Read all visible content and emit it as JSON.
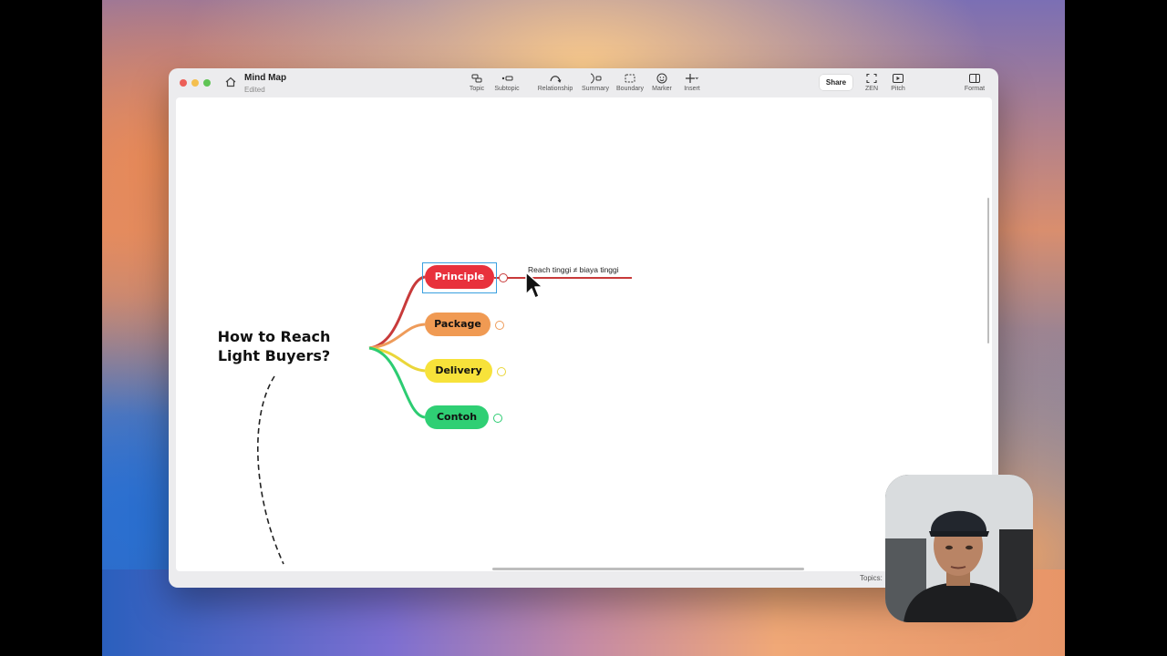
{
  "window": {
    "title": "Mind Map",
    "subtitle": "Edited"
  },
  "toolbar": {
    "tools": [
      {
        "label": "Topic",
        "icon": "topic-icon"
      },
      {
        "label": "Subtopic",
        "icon": "subtopic-icon"
      },
      {
        "label": "Relationship",
        "icon": "relationship-icon"
      },
      {
        "label": "Summary",
        "icon": "summary-icon"
      },
      {
        "label": "Boundary",
        "icon": "boundary-icon"
      },
      {
        "label": "Marker",
        "icon": "marker-icon"
      },
      {
        "label": "Insert",
        "icon": "insert-icon"
      }
    ],
    "share_label": "Share",
    "right_tools": [
      {
        "label": "ZEN",
        "icon": "zen-icon"
      },
      {
        "label": "Pitch",
        "icon": "pitch-icon"
      },
      {
        "label": "Format",
        "icon": "format-icon"
      }
    ]
  },
  "mindmap": {
    "central_topic": "How to Reach Light Buyers?",
    "branches": [
      {
        "label": "Principle",
        "color": "#e8313c",
        "selected": true
      },
      {
        "label": "Package",
        "color": "#f09a53"
      },
      {
        "label": "Delivery",
        "color": "#f7e23a"
      },
      {
        "label": "Contoh",
        "color": "#2fcf74"
      }
    ],
    "subtopic": "Reach tinggi ≠ biaya tinggi"
  },
  "status": {
    "topics_label": "Topics:"
  }
}
